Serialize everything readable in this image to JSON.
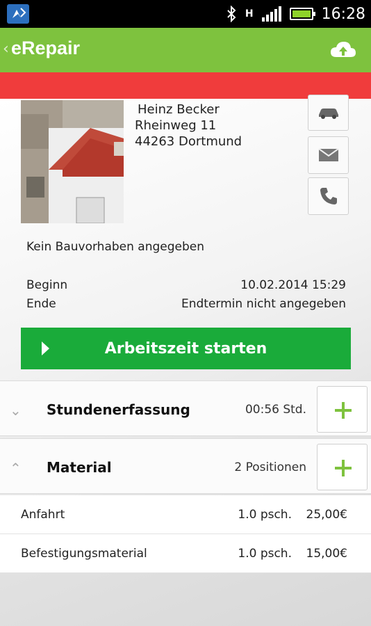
{
  "status_bar": {
    "time": "16:28",
    "network": "H",
    "icons": [
      "bluetooth-icon",
      "signal-icon",
      "battery-icon"
    ]
  },
  "app_bar": {
    "title": "eRepair",
    "back_icon": "chevron-left-icon",
    "action_icon": "cloud-upload-icon",
    "accent_color": "#7ec23e",
    "alert_color": "#f03c3c"
  },
  "customer": {
    "name": "Heinz Becker",
    "street": "Rheinweg 11",
    "city": "44263 Dortmund"
  },
  "actions": [
    {
      "name": "car-icon"
    },
    {
      "name": "mail-icon"
    },
    {
      "name": "phone-icon"
    }
  ],
  "project": "Kein Bauvorhaben angegeben",
  "schedule": {
    "start_label": "Beginn",
    "start_value": "10.02.2014 15:29",
    "end_label": "Ende",
    "end_value": "Endtermin nicht angegeben"
  },
  "start_button": {
    "label": "Arbeitszeit starten",
    "color": "#1aab3a"
  },
  "sections": [
    {
      "title": "Stundenerfassung",
      "info": "00:56 Std.",
      "expanded": false
    },
    {
      "title": "Material",
      "info": "2 Positionen",
      "expanded": true
    }
  ],
  "materials": [
    {
      "name": "Anfahrt",
      "qty": "1.0 psch.",
      "price": "25,00€"
    },
    {
      "name": "Befestigungsmaterial",
      "qty": "1.0 psch.",
      "price": "15,00€"
    }
  ]
}
